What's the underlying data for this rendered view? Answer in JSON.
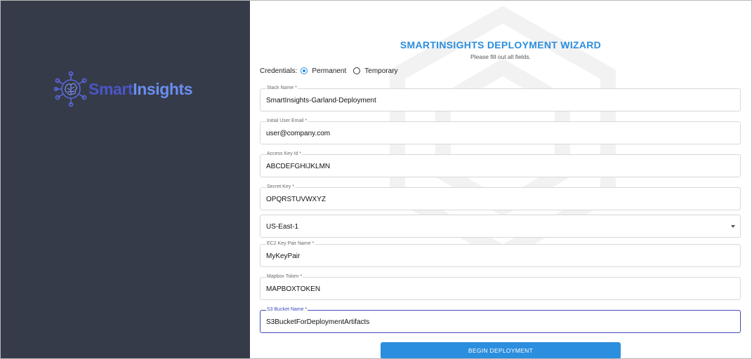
{
  "brand": {
    "name_part1": "Smart",
    "name_part2": "Insights"
  },
  "wizard": {
    "title": "SMARTINSIGHTS DEPLOYMENT WIZARD",
    "subtitle": "Please fill out all fields.",
    "credentials": {
      "label": "Credentials:",
      "options": [
        {
          "label": "Permanent",
          "selected": true
        },
        {
          "label": "Temporary",
          "selected": false
        }
      ]
    },
    "fields": {
      "stack_name": {
        "label": "Stack Name",
        "required_mark": "*",
        "value": "SmartInsights-Garland-Deployment"
      },
      "email": {
        "label": "Initial User Email",
        "required_mark": "*",
        "value": "user@company.com"
      },
      "access_key": {
        "label": "Access Key Id",
        "required_mark": "*",
        "value": "ABCDEFGHIJKLMN"
      },
      "secret_key": {
        "label": "Secret Key",
        "required_mark": "*",
        "value": "OPQRSTUVWXYZ"
      },
      "region": {
        "value": "US-East-1"
      },
      "key_pair": {
        "label": "EC2 Key Pair Name",
        "required_mark": "*",
        "value": "MyKeyPair"
      },
      "mapbox": {
        "label": "Mapbox Token",
        "required_mark": "*",
        "value": "MAPBOXTOKEN"
      },
      "s3_bucket": {
        "label": "S3 Bucket Name",
        "required_mark": "*",
        "value": "S3BucketForDeploymentArtifacts"
      }
    },
    "submit_label": "BEGIN DEPLOYMENT"
  },
  "colors": {
    "sidebar": "#353b48",
    "accent": "#2b8ede",
    "focus": "#3f4bb8"
  }
}
